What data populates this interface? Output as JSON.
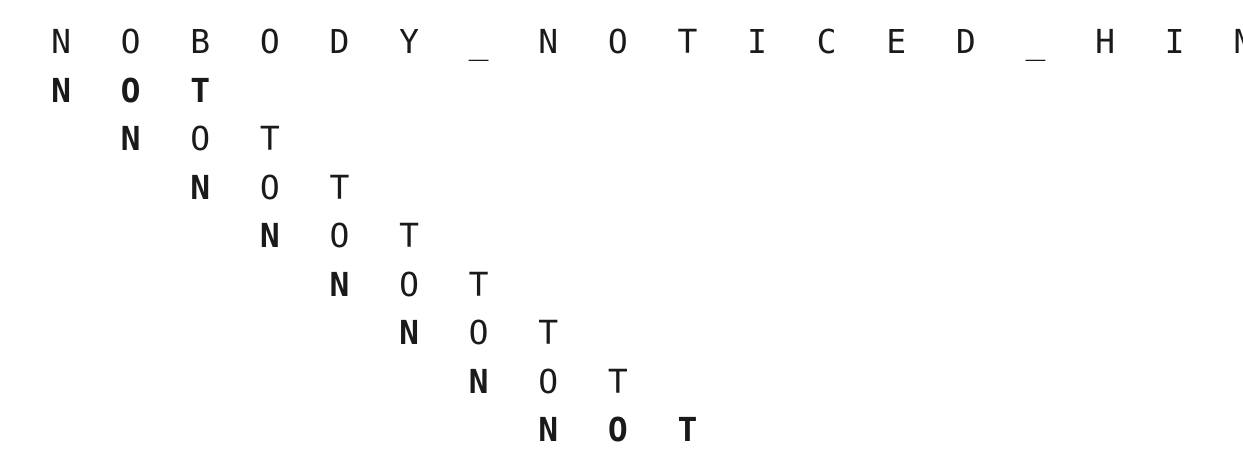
{
  "text": [
    "N",
    "O",
    "B",
    "O",
    "D",
    "Y",
    "_",
    "N",
    "O",
    "T",
    "I",
    "C",
    "E",
    "D",
    "_",
    "H",
    "I",
    "M"
  ],
  "pattern": [
    "N",
    "O",
    "T"
  ],
  "alignments": [
    {
      "shift": 0,
      "bold": [
        true,
        true,
        true
      ]
    },
    {
      "shift": 1,
      "bold": [
        true,
        false,
        false
      ]
    },
    {
      "shift": 2,
      "bold": [
        true,
        false,
        false
      ]
    },
    {
      "shift": 3,
      "bold": [
        true,
        false,
        false
      ]
    },
    {
      "shift": 4,
      "bold": [
        true,
        false,
        false
      ]
    },
    {
      "shift": 5,
      "bold": [
        true,
        false,
        false
      ]
    },
    {
      "shift": 6,
      "bold": [
        true,
        false,
        false
      ]
    },
    {
      "shift": 7,
      "bold": [
        true,
        true,
        true
      ]
    }
  ]
}
